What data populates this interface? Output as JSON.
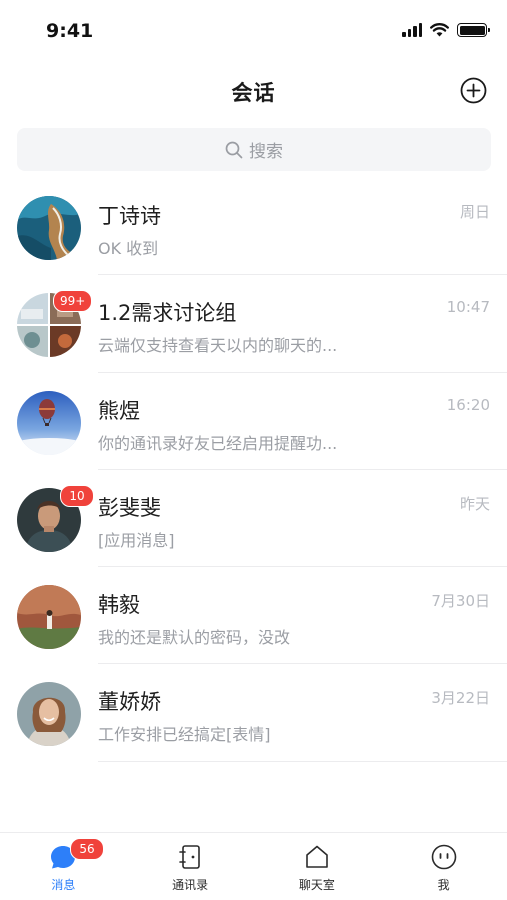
{
  "status_bar": {
    "time": "9:41"
  },
  "header": {
    "title": "会话",
    "add_icon": "plus-circle-icon"
  },
  "search": {
    "placeholder": "搜索",
    "icon": "search-icon"
  },
  "conversations": [
    {
      "name": "丁诗诗",
      "preview": "OK 收到",
      "time": "周日",
      "badge": "",
      "avatar": "coast-photo"
    },
    {
      "name": "1.2需求讨论组",
      "preview": "云端仅支持查看天以内的聊天的...",
      "time": "10:47",
      "badge": "99+",
      "avatar": "group-collage"
    },
    {
      "name": "熊煜",
      "preview": "你的通讯录好友已经启用提醒功...",
      "time": "16:20",
      "badge": "",
      "avatar": "balloon-photo"
    },
    {
      "name": "彭斐斐",
      "preview": "[应用消息]",
      "time": "昨天",
      "badge": "10",
      "avatar": "man-portrait"
    },
    {
      "name": "韩毅",
      "preview": "我的还是默认的密码，没改",
      "time": "7月30日",
      "badge": "",
      "avatar": "canyon-photo"
    },
    {
      "name": "董娇娇",
      "preview": "工作安排已经搞定[表情]",
      "time": "3月22日",
      "badge": "",
      "avatar": "woman-portrait"
    }
  ],
  "tab_bar": {
    "tabs": [
      {
        "label": "消息",
        "icon": "message-bubble-icon",
        "active": true,
        "badge": "56"
      },
      {
        "label": "通讯录",
        "icon": "contacts-book-icon",
        "active": false
      },
      {
        "label": "聊天室",
        "icon": "house-icon",
        "active": false
      },
      {
        "label": "我",
        "icon": "face-icon",
        "active": false
      }
    ]
  },
  "colors": {
    "accent": "#2d7ff9",
    "badge": "#f0423b",
    "muted_text": "#9b9ea4",
    "time_text": "#b7bac0"
  }
}
